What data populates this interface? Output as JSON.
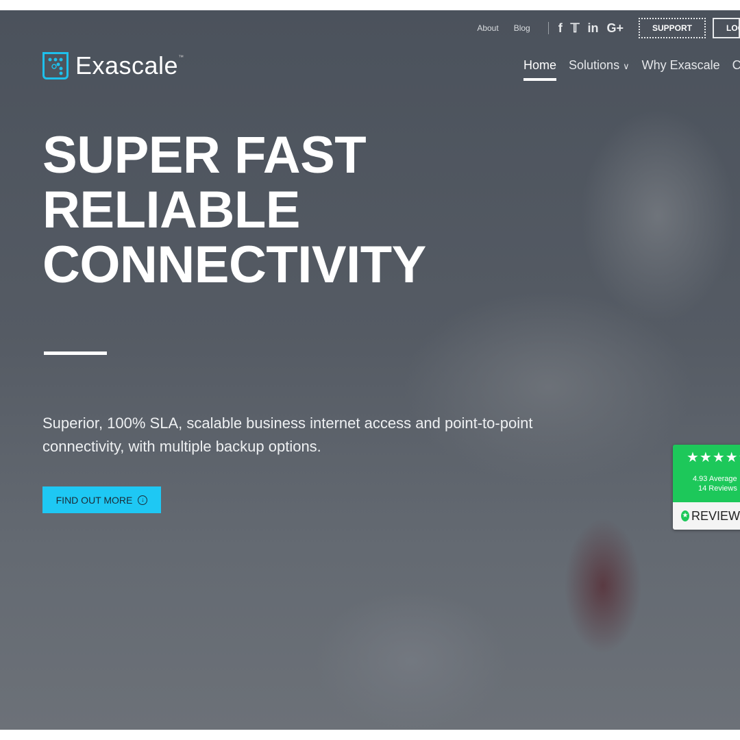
{
  "topbar": {
    "links": [
      "About",
      "Blog"
    ],
    "social": [
      {
        "icon": "facebook-icon",
        "glyph": "f"
      },
      {
        "icon": "twitter-icon",
        "glyph": "🐦"
      },
      {
        "icon": "linkedin-icon",
        "glyph": "in"
      },
      {
        "icon": "google-plus-icon",
        "glyph": "G+"
      }
    ],
    "support": "SUPPORT",
    "login": "LOGIN"
  },
  "logo": {
    "text": "Exascale",
    "tm": "™"
  },
  "nav": {
    "items": [
      "Home",
      "Solutions",
      "Why Exascale",
      "Contact"
    ],
    "active": "Home"
  },
  "hero": {
    "title_lines": [
      "SUPER FAST",
      "RELIABLE",
      "CONNECTIVITY"
    ],
    "subtitle": "Superior, 100% SLA, scalable business internet access and point-to-point connectivity, with multiple backup options.",
    "cta": "FIND OUT MORE"
  },
  "reviews": {
    "stars": "★★★★★",
    "average": "4.93 Average",
    "count": "14 Reviews",
    "brand": "REVIEWS"
  },
  "colors": {
    "accent": "#1ec8f4",
    "reviews_green": "#1dc85a"
  }
}
